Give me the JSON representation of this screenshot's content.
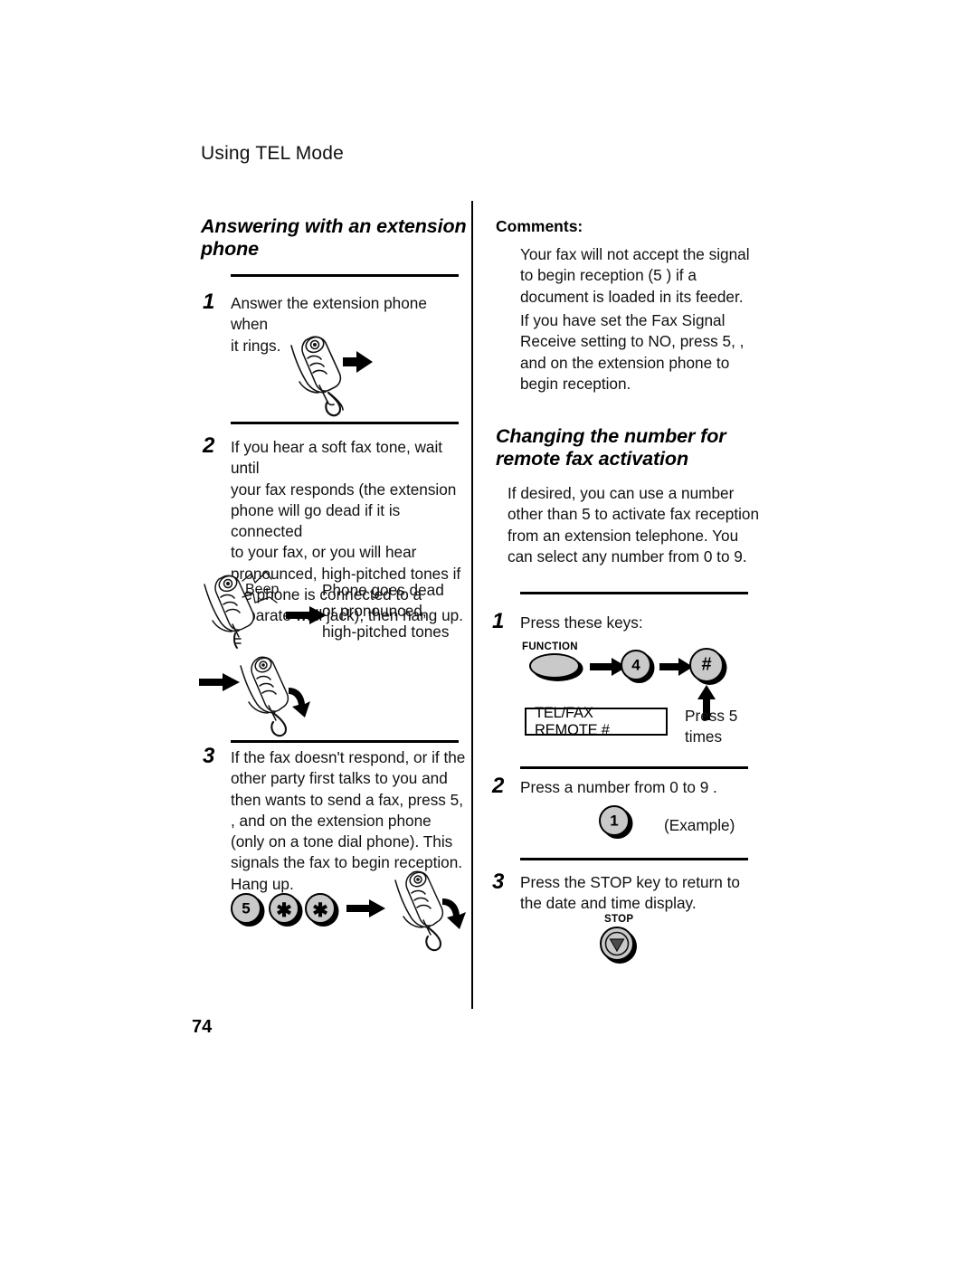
{
  "page": {
    "running_head": "Using TEL Mode",
    "page_number": "74"
  },
  "left_column": {
    "section_title_line1": "Answering with an extension",
    "section_title_line2": "phone",
    "steps": [
      {
        "number": "1",
        "lines": [
          "Answer the extension phone when",
          "it rings."
        ]
      },
      {
        "number": "2",
        "lines": [
          "If you hear a soft fax tone, wait until",
          "your fax responds (the extension",
          "phone will go dead if it is connected",
          "to your fax, or you will hear",
          "pronounced, high-pitched tones if",
          "the phone is connected to a",
          "separate wall jack), then hang up."
        ]
      },
      {
        "number": "3",
        "lines": [
          "If the fax doesn't respond, or if the",
          "other party first talks to you and",
          "then wants to send a fax, press 5,",
          "  , and    on the extension phone",
          "(only on a tone dial phone). This",
          "signals the fax to begin reception.",
          "Hang up."
        ]
      }
    ],
    "beep_label": "Beep",
    "result_caption": [
      "Phone goes dead",
      "or pronounced,",
      "high-pitched tones"
    ],
    "step3_keys": [
      {
        "label": "5",
        "kind": "digit"
      },
      {
        "label": "✱",
        "kind": "star"
      },
      {
        "label": "✱",
        "kind": "star"
      }
    ]
  },
  "right_column": {
    "comments_label": "Comments:",
    "comment_paragraphs": [
      [
        "Your fax will not accept the signal",
        "to begin reception (5     ) if a",
        "document is loaded in its feeder."
      ],
      [
        "If you have set the Fax Signal",
        "Receive setting to NO, press 5,    ,",
        "and    on the extension phone to",
        "begin reception."
      ]
    ],
    "section_title_line1": "Changing the number for",
    "section_title_line2": "remote fax activation",
    "intro_lines": [
      "If desired, you can use a number",
      "other than 5 to activate fax reception",
      "from an extension telephone. You",
      "can select any number from 0 to 9."
    ],
    "steps": [
      {
        "number": "1",
        "lines": [
          "Press these keys:"
        ]
      },
      {
        "number": "2",
        "lines": [
          "Press a number from 0 to 9 ."
        ]
      },
      {
        "number": "3",
        "lines": [
          "Press the STOP key to return to",
          "the date and time display."
        ]
      }
    ],
    "function_key_label": "FUNCTION",
    "key_four_label": "4",
    "key_hash_label": "#",
    "lcd_text": "TEL/FAX REMOTE #",
    "press_note_line1": "Press 5",
    "press_note_line2": "times",
    "example_key_label": "1",
    "example_note": "(Example)",
    "stop_key_label": "STOP"
  },
  "colors": {
    "ink": "#000000",
    "paper": "#ffffff",
    "key_face": "#c9c9c9"
  }
}
